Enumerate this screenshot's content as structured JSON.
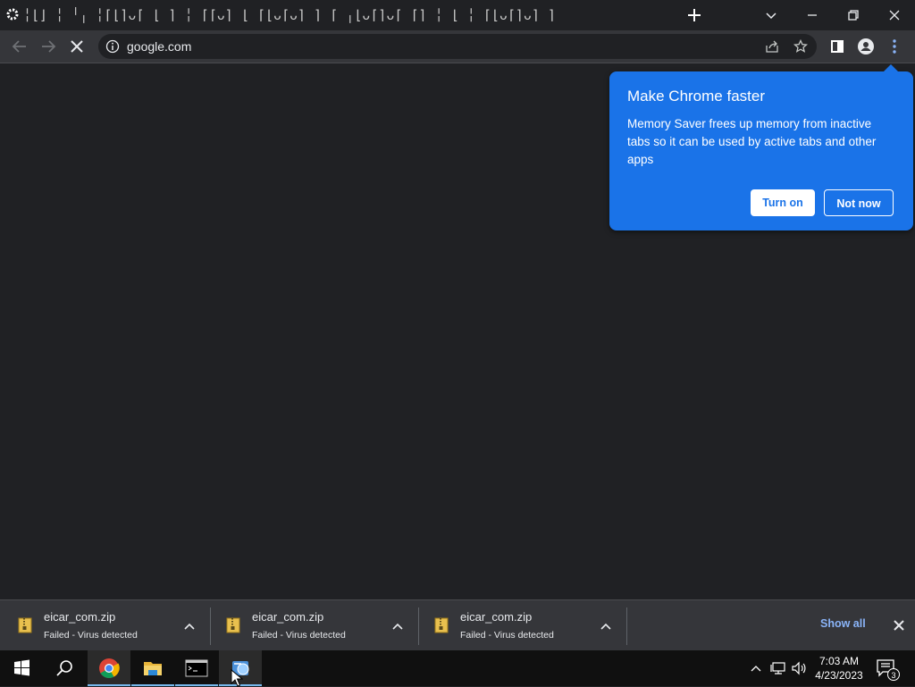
{
  "tabstrip": {
    "tabs_text": "╎⌊⌋ ╎ ╵╷ ╎⌈⌊⌉ᴗ⌈ ⌊ ⌉ ╎ ⌈⌈ᴗ⌉ ⌊ ⌈⌊ᴗ⌈ᴗ⌉ ⌉ ⌈ ╷⌊ᴗ⌈⌉ᴗ⌈ ⌈⌉ ╎ ⌊ ╎ ⌈⌊ᴗ⌈⌉ᴗ⌉ ⌉"
  },
  "toolbar": {
    "url": "google.com"
  },
  "promo": {
    "title": "Make Chrome faster",
    "body": "Memory Saver frees up memory from inactive tabs so it can be used by active tabs and other apps",
    "turn_on_label": "Turn on",
    "not_now_label": "Not now"
  },
  "downloads": {
    "items": [
      {
        "name": "eicar_com.zip",
        "status": "Failed - Virus detected"
      },
      {
        "name": "eicar_com.zip",
        "status": "Failed - Virus detected"
      },
      {
        "name": "eicar_com.zip",
        "status": "Failed - Virus detected"
      }
    ],
    "show_all_label": "Show all"
  },
  "taskbar": {
    "time": "7:03 AM",
    "date": "4/23/2023",
    "notification_count": "3"
  },
  "colors": {
    "accent": "#1a73e8",
    "link": "#8ab4f8",
    "frame": "#202124",
    "toolbar": "#35363a"
  },
  "icons": [
    "settings-gear-icon",
    "new-tab-icon",
    "tab-search-icon",
    "minimize-icon",
    "restore-icon",
    "close-window-icon",
    "back-icon",
    "forward-icon",
    "stop-icon",
    "site-info-icon",
    "share-icon",
    "bookmark-star-icon",
    "side-panel-icon",
    "profile-icon",
    "menu-kebab-icon",
    "zip-file-icon",
    "chevron-up-icon",
    "close-icon",
    "windows-start-icon",
    "search-icon",
    "chrome-icon",
    "file-explorer-icon",
    "cmd-icon",
    "app-icon",
    "tray-chevron-icon",
    "network-icon",
    "volume-icon",
    "notification-icon"
  ]
}
